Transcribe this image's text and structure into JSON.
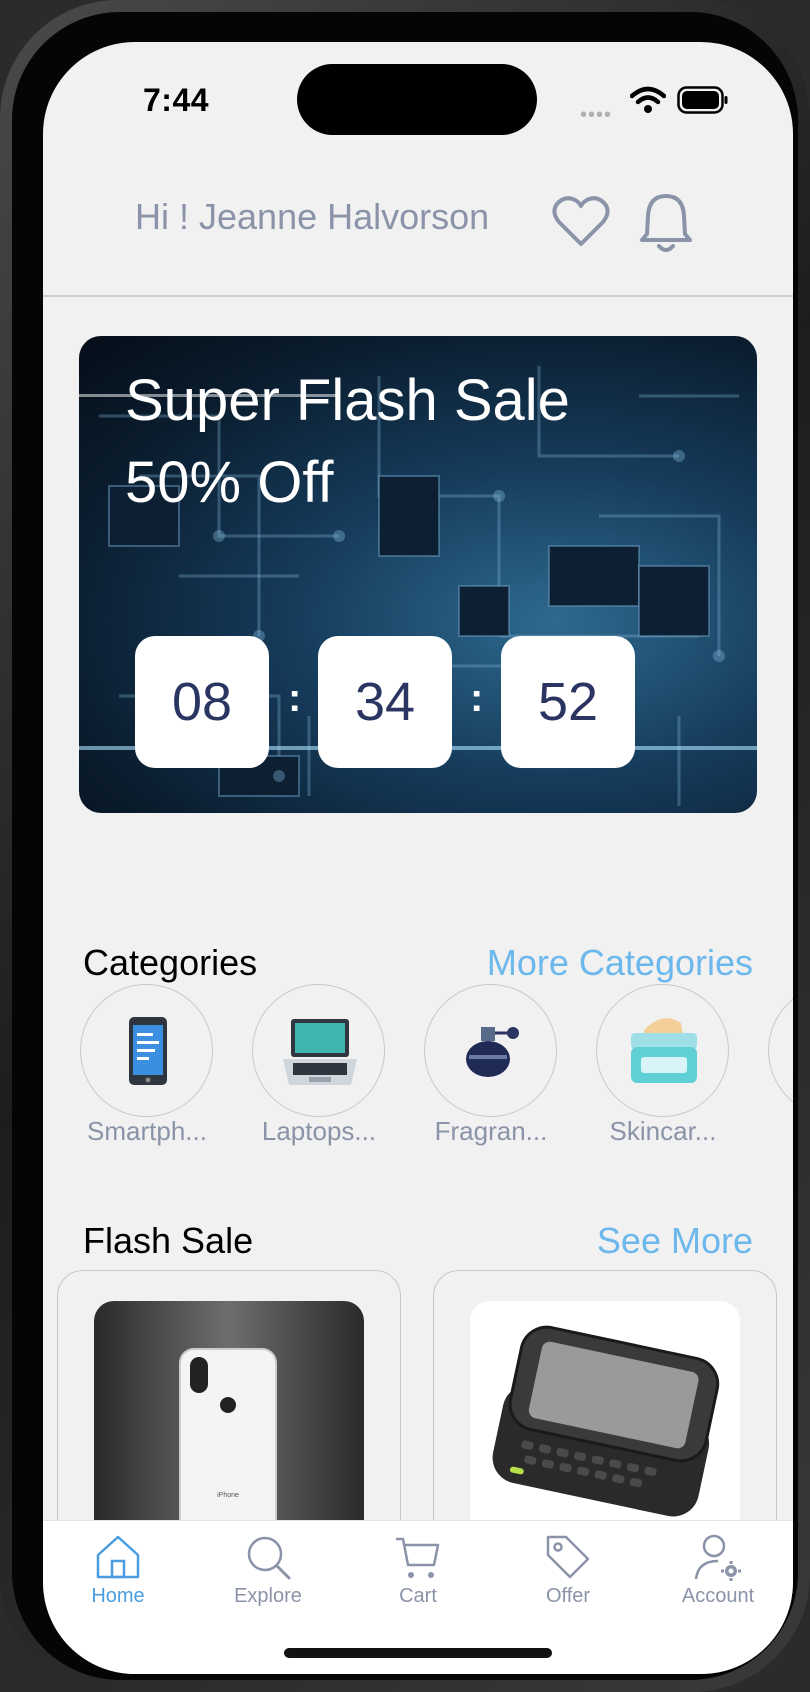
{
  "status_bar": {
    "time": "7:44"
  },
  "header": {
    "greeting": "Hi !  Jeanne Halvorson",
    "favorite_icon": "heart-icon",
    "notification_icon": "bell-icon"
  },
  "banner": {
    "title_line1": "Super Flash Sale",
    "title_line2": "50% Off",
    "countdown": {
      "hours": "08",
      "minutes": "34",
      "seconds": "52",
      "separator": ":"
    }
  },
  "categories": {
    "title": "Categories",
    "more_label": "More Categories",
    "items": [
      {
        "label": "Smartph...",
        "icon": "smartphone-icon"
      },
      {
        "label": "Laptops...",
        "icon": "laptop-icon"
      },
      {
        "label": "Fragran...",
        "icon": "perfume-icon"
      },
      {
        "label": "Skincar...",
        "icon": "skincare-jar-icon"
      }
    ]
  },
  "flash_sale": {
    "title": "Flash Sale",
    "more_label": "See More",
    "products": [
      {
        "image": "white-iphone-image"
      },
      {
        "image": "slider-phone-image"
      }
    ]
  },
  "tab_bar": {
    "tabs": [
      {
        "label": "Home",
        "icon": "home-icon",
        "active": true
      },
      {
        "label": "Explore",
        "icon": "search-icon",
        "active": false
      },
      {
        "label": "Cart",
        "icon": "cart-icon",
        "active": false
      },
      {
        "label": "Offer",
        "icon": "tag-icon",
        "active": false
      },
      {
        "label": "Account",
        "icon": "account-icon",
        "active": false
      }
    ]
  },
  "colors": {
    "accent": "#6cb8ec",
    "active_tab": "#4a9de0",
    "inactive_tab": "#8a93a8",
    "countdown_text": "#2b3561",
    "background": "#f1f1f2"
  }
}
